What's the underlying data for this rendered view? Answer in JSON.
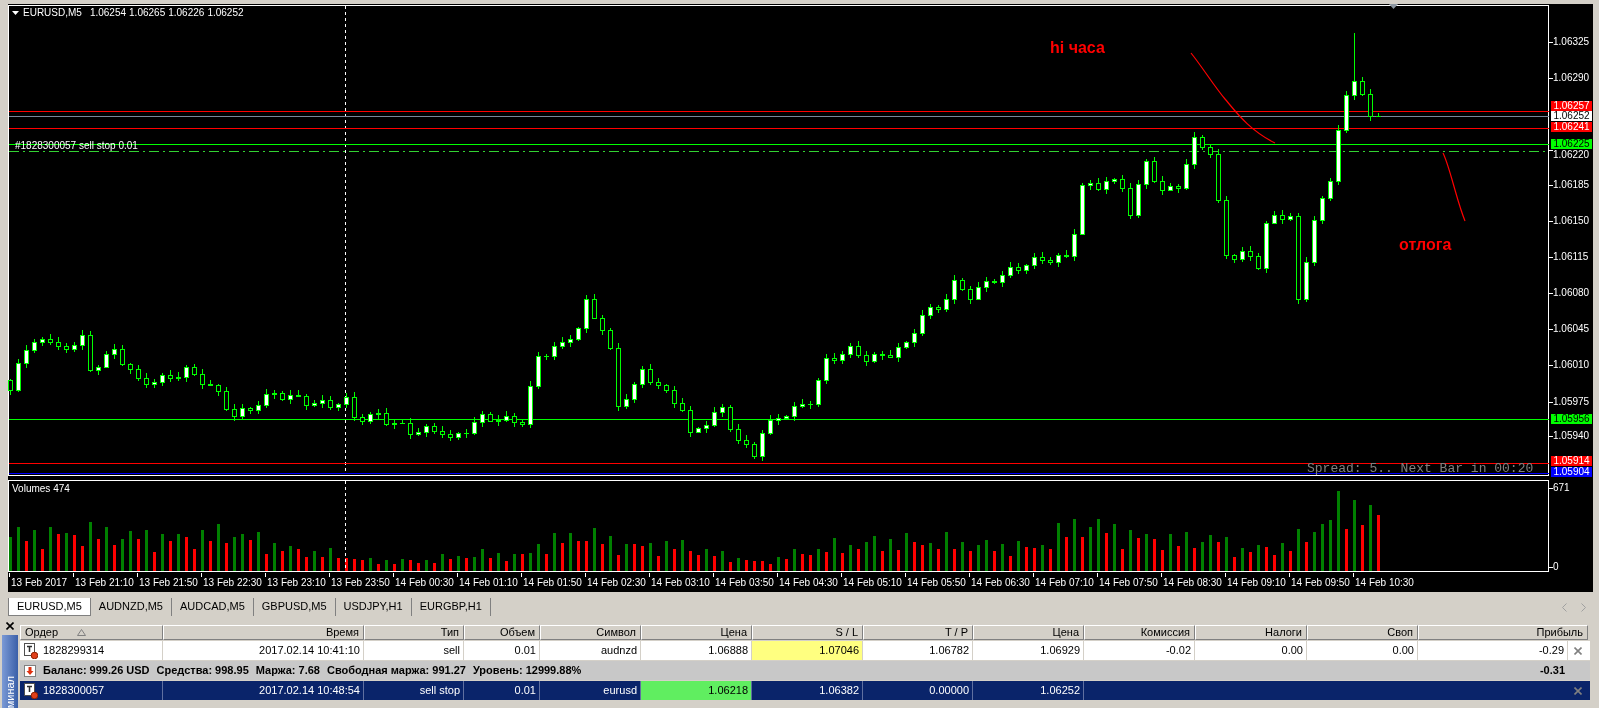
{
  "chart": {
    "symbol": "EURUSD,M5",
    "ohlc": [
      "1.06254",
      "1.06265",
      "1.06226",
      "1.06252"
    ],
    "price_ticks": [
      "1.06325",
      "1.06290",
      "1.06220",
      "1.06185",
      "1.06150",
      "1.06115",
      "1.06080",
      "1.06045",
      "1.06010",
      "1.05975",
      "1.05940"
    ],
    "price_levels": [
      {
        "label": "1.06257",
        "color": "#ff0000",
        "line": {
          "color": "#ff0000"
        }
      },
      {
        "label": "1.06252",
        "color": "#ffffff",
        "line": {
          "color": "#778899"
        }
      },
      {
        "label": "1.06241",
        "color": "#ff0000",
        "line": {
          "color": "#ff0000"
        }
      },
      {
        "label": "1.06225",
        "color": "#00ff00",
        "line": {
          "color": "#00ff00"
        }
      },
      {
        "label": "1.05956",
        "color": "#00ff00",
        "line": {
          "color": "#00ff00"
        }
      },
      {
        "label": "1.05914",
        "color": "#ff0000",
        "line": {
          "color": "#ff0000"
        }
      },
      {
        "label": "1.05904",
        "color": "#0000ff",
        "line": {
          "color": "#0000ff"
        }
      }
    ],
    "order_line": {
      "caption": "#1828300057 sell stop 0.01"
    },
    "status_text": "Spread: 5.. Next Bar in 00:20",
    "annotations": [
      "hi часа",
      "отлога"
    ]
  },
  "volumes": {
    "title": "Volumes 474",
    "scale_max": "671",
    "scale_min": "0"
  },
  "time_labels": [
    "13 Feb 2017",
    "13 Feb 21:10",
    "13 Feb 21:50",
    "13 Feb 22:30",
    "13 Feb 23:10",
    "13 Feb 23:50",
    "14 Feb 00:30",
    "14 Feb 01:10",
    "14 Feb 01:50",
    "14 Feb 02:30",
    "14 Feb 03:10",
    "14 Feb 03:50",
    "14 Feb 04:30",
    "14 Feb 05:10",
    "14 Feb 05:50",
    "14 Feb 06:30",
    "14 Feb 07:10",
    "14 Feb 07:50",
    "14 Feb 08:30",
    "14 Feb 09:10",
    "14 Feb 09:50",
    "14 Feb 10:30"
  ],
  "tabs": [
    {
      "label": "EURUSD,M5",
      "selected": true
    },
    {
      "label": "AUDNZD,M5",
      "selected": false
    },
    {
      "label": "AUDCAD,M5",
      "selected": false
    },
    {
      "label": "GBPUSD,M5",
      "selected": false
    },
    {
      "label": "USDJPY,H1",
      "selected": false
    },
    {
      "label": "EURGBP,H1",
      "selected": false
    }
  ],
  "terminal": {
    "side_title": "минал",
    "columns": [
      {
        "label": "Ордер",
        "sorted": true
      },
      {
        "label": "Время",
        "sorted": false
      },
      {
        "label": "Тип",
        "sorted": false
      },
      {
        "label": "Объем",
        "sorted": false
      },
      {
        "label": "Символ",
        "sorted": false
      },
      {
        "label": "Цена",
        "sorted": false
      },
      {
        "label": "S / L",
        "sorted": false
      },
      {
        "label": "T / P",
        "sorted": false
      },
      {
        "label": "Цена",
        "sorted": false
      },
      {
        "label": "Комиссия",
        "sorted": false
      },
      {
        "label": "Налоги",
        "sorted": false
      },
      {
        "label": "Своп",
        "sorted": false
      },
      {
        "label": "Прибыль",
        "sorted": false
      }
    ],
    "rows": [
      {
        "kind": "order",
        "selected": false,
        "cells": [
          {
            "text": "1828299314"
          },
          {
            "text": "2017.02.14 10:41:10"
          },
          {
            "text": "sell"
          },
          {
            "text": "0.01"
          },
          {
            "text": "audnzd"
          },
          {
            "text": "1.06888"
          },
          {
            "text": "1.07046",
            "color": "#ffff80"
          },
          {
            "text": "1.06782"
          },
          {
            "text": "1.06929"
          },
          {
            "text": "-0.02"
          },
          {
            "text": "0.00"
          },
          {
            "text": "0.00"
          },
          {
            "text": "-0.29"
          }
        ]
      },
      {
        "kind": "summary",
        "selected": false,
        "items": [
          "Баланс: 999.26 USD",
          "Средства: 998.95",
          "Маржа: 7.68",
          "Свободная маржа: 991.27",
          "Уровень: 12999.88%"
        ],
        "total": "-0.31"
      },
      {
        "kind": "order",
        "selected": true,
        "cells": [
          {
            "text": "1828300057"
          },
          {
            "text": "2017.02.14 10:48:54"
          },
          {
            "text": "sell stop"
          },
          {
            "text": "0.01"
          },
          {
            "text": "eurusd"
          },
          {
            "text": "1.06218",
            "color": "#60ee60"
          },
          {
            "text": "1.06382"
          },
          {
            "text": "0.00000"
          },
          {
            "text": "1.06252"
          }
        ]
      }
    ]
  }
}
